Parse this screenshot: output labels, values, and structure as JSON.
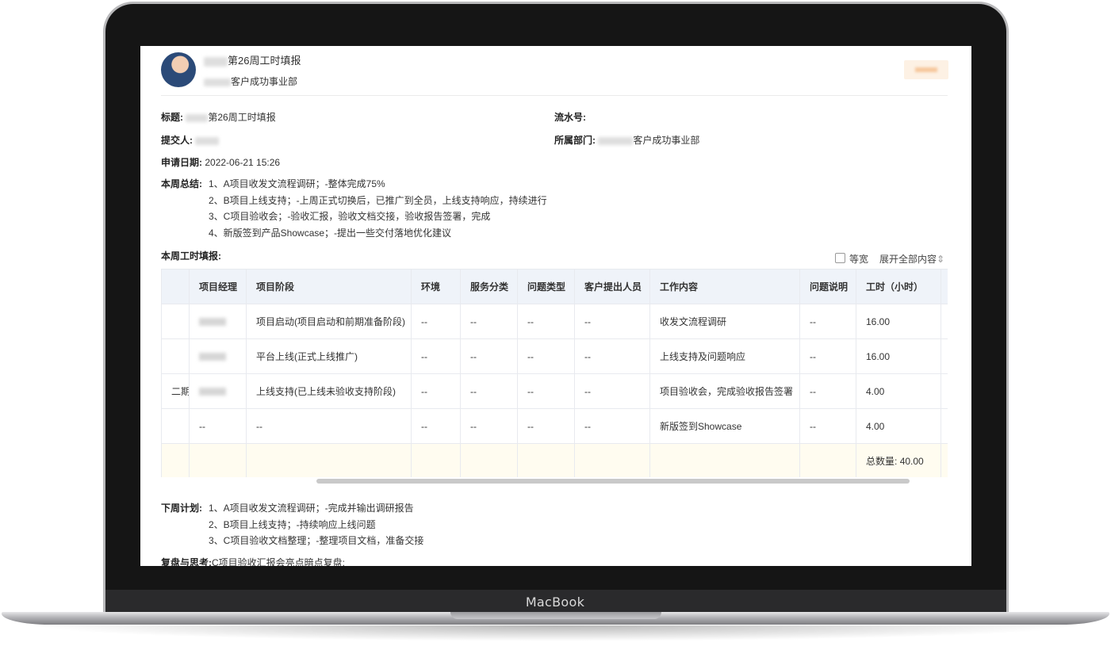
{
  "device": {
    "brand": "MacBook"
  },
  "header": {
    "title_suffix": "第26周工时填报",
    "dept_suffix": "客户成功事业部"
  },
  "info": {
    "title_label": "标题:",
    "title_value": "第26周工时填报",
    "serial_label": "流水号:",
    "serial_value": "",
    "submitter_label": "提交人:",
    "dept_label": "所属部门:",
    "dept_value": "客户成功事业部",
    "date_label": "申请日期:",
    "date_value": "2022-06-21 15:26"
  },
  "summary": {
    "label": "本周总结:",
    "lines": [
      "1、A项目收发文流程调研；-整体完成75%",
      "2、B项目上线支持；-上周正式切换后，已推广到全员，上线支持响应，持续进行",
      "3、C项目验收会；-验收汇报，验收文档交接，验收报告签署，完成",
      "4、新版签到产品Showcase；-提出一些交付落地优化建议"
    ]
  },
  "timesheet": {
    "label": "本周工时填报:",
    "equal_width_label": "等宽",
    "expand_all_label": "展开全部内容",
    "columns": [
      "项目经理",
      "项目阶段",
      "环境",
      "服务分类",
      "问题类型",
      "客户提出人员",
      "工作内容",
      "问题说明",
      "工时（小时）"
    ],
    "rows": [
      {
        "project": "",
        "manager": "",
        "stage": "项目启动(项目启动和前期准备阶段)",
        "env": "--",
        "service": "--",
        "issue": "--",
        "client": "--",
        "work": "收发文流程调研",
        "desc": "--",
        "hours": "16.00"
      },
      {
        "project": "",
        "manager": "",
        "stage": "平台上线(正式上线推广)",
        "env": "--",
        "service": "--",
        "issue": "--",
        "client": "--",
        "work": "上线支持及问题响应",
        "desc": "--",
        "hours": "16.00"
      },
      {
        "project": "二期",
        "manager": "",
        "stage": "上线支持(已上线未验收支持阶段)",
        "env": "--",
        "service": "--",
        "issue": "--",
        "client": "--",
        "work": "项目验收会，完成验收报告签署",
        "desc": "--",
        "hours": "4.00"
      },
      {
        "project": "",
        "manager": "--",
        "stage": "--",
        "env": "--",
        "service": "--",
        "issue": "--",
        "client": "--",
        "work": "新版签到Showcase",
        "desc": "--",
        "hours": "4.00"
      }
    ],
    "total_label": "总数量:",
    "total_value": "40.00"
  },
  "next_plan": {
    "label": "下周计划:",
    "lines": [
      "1、A项目收发文流程调研；-完成并输出调研报告",
      "2、B项目上线支持；-持续响应上线问题",
      "3、C项目验收文档整理；-整理项目文档，准备交接"
    ]
  },
  "review": {
    "label": "复盘与思考:",
    "value": "C项目验收汇报会亮点暗点复盘;"
  }
}
